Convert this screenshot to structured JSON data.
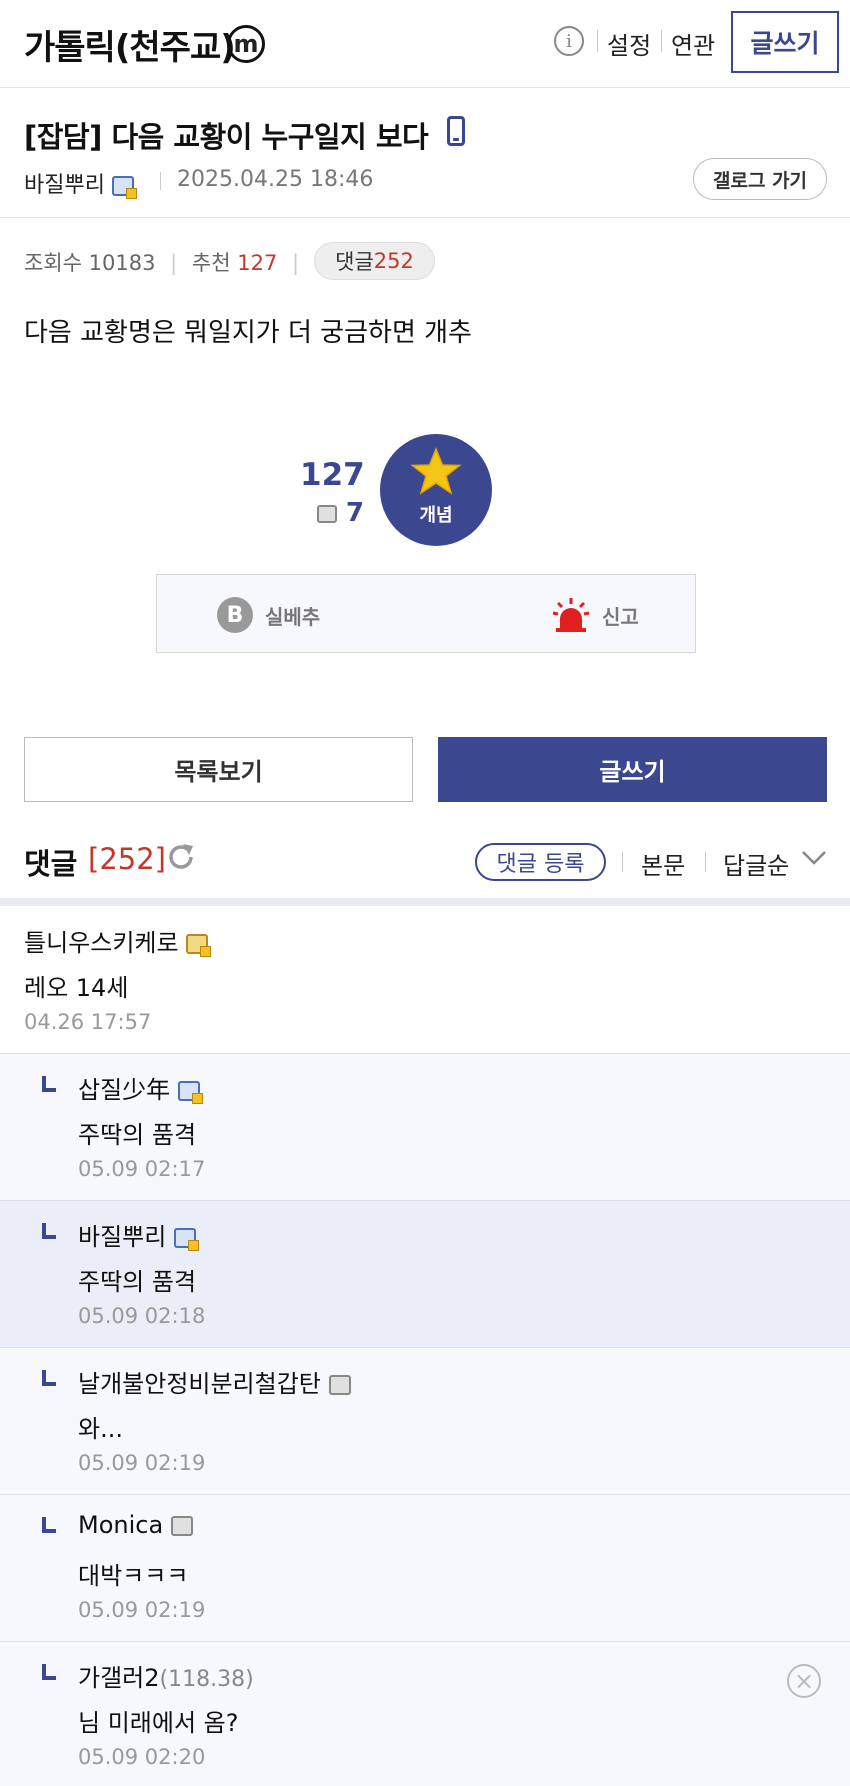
{
  "header": {
    "gallery_name": "가톨릭(천주교)",
    "minor_badge": "m",
    "info_icon": "i",
    "settings": "설정",
    "related": "연관",
    "write": "글쓰기"
  },
  "post": {
    "title": "[잡담] 다음 교황이 누구일지 보다",
    "author": "바질뿌리",
    "date": "2025.04.25 18:46",
    "gallery_go": "갤로그 가기",
    "views_label": "조회수",
    "views": "10183",
    "rec_label": "추천",
    "rec": "127",
    "comments_label": "댓글",
    "comments": "252",
    "body": "다음 교황명은 뭐일지가 더 궁금하면 개추"
  },
  "recommend": {
    "count": "127",
    "fixed_count": "7",
    "concept_label": "개념",
    "b_icon": "B",
    "silbechu": "실베추",
    "report": "신고"
  },
  "buttons": {
    "list": "목록보기",
    "write": "글쓰기"
  },
  "comment_header": {
    "title": "댓글",
    "count": "[252]",
    "register": "댓글 등록",
    "body": "본문",
    "sort": "답글순"
  },
  "comments": [
    {
      "name": "틀니우스키케로",
      "ip": "",
      "text": "레오 14세",
      "time": "04.26 17:57"
    },
    {
      "name": "삽질少年",
      "ip": "",
      "text": "주딱의 품격",
      "time": "05.09 02:17"
    },
    {
      "name": "바질뿌리",
      "ip": "",
      "text": "주딱의 품격",
      "time": "05.09 02:18"
    },
    {
      "name": "날개불안정비분리철갑탄",
      "ip": "",
      "text": "와...",
      "time": "05.09 02:19"
    },
    {
      "name": "Monica",
      "ip": "",
      "text": "대박ㅋㅋㅋ",
      "time": "05.09 02:19"
    },
    {
      "name": "가갤러2",
      "ip": "(118.38)",
      "text": "님 미래에서 옴?",
      "time": "05.09 02:20"
    }
  ],
  "colors": {
    "accent": "#3b4890",
    "red": "#c0392b",
    "highlight": "#eaeef8"
  },
  "icons": {
    "minor": "minor-gallery-icon",
    "info": "info-icon",
    "phone": "mobile-phone-icon",
    "fixed": "fixed-nick-icon",
    "star": "star-icon",
    "siren": "siren-icon",
    "refresh": "refresh-icon",
    "chevron": "chevron-down-icon",
    "delete": "close-circle-icon",
    "reply": "reply-arrow-icon"
  }
}
